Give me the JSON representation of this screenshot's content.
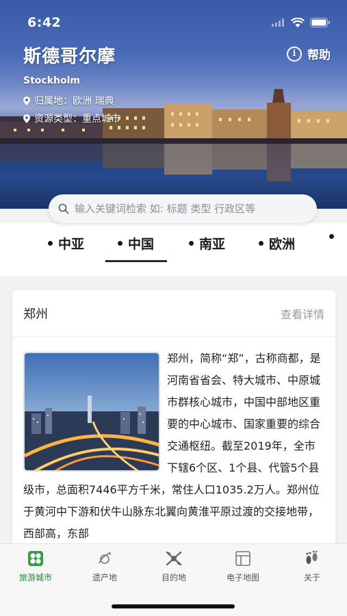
{
  "status": {
    "time": "6:42"
  },
  "hero": {
    "title": "斯德哥尔摩",
    "subtitle": "Stockholm",
    "region_label": "归属地：欧洲 瑞典",
    "resource_label": "资源类型：重点城市",
    "help_label": "帮助"
  },
  "search": {
    "placeholder": "输入关键词检索 如: 标题 类型 行政区等"
  },
  "tabs": [
    {
      "label": ""
    },
    {
      "label": "中亚"
    },
    {
      "label": "中国"
    },
    {
      "label": "南亚"
    },
    {
      "label": "欧洲"
    },
    {
      "label": ""
    }
  ],
  "active_tab": "中国",
  "card": {
    "title": "郑州",
    "link": "查看详情",
    "description": "郑州，简称“郑”，古称商都，是河南省省会、特大城市、中原城市群核心城市，中国中部地区重要的中心城市、国家重要的综合交通枢纽。截至2019年，全市下辖6个区、1个县、代管5个县级市，总面积7446平方千米，常住人口1035.2万人。郑州位于黄河中下游和伏牛山脉东北翼向黄淮平原过渡的交接地带，西部高，东部"
  },
  "bottom_nav": [
    {
      "label": "旅游城市",
      "icon": "city-grid-icon",
      "active": true
    },
    {
      "label": "遗产地",
      "icon": "heritage-icon",
      "active": false
    },
    {
      "label": "目的地",
      "icon": "destination-icon",
      "active": false
    },
    {
      "label": "电子地图",
      "icon": "map-icon",
      "active": false
    },
    {
      "label": "关于",
      "icon": "about-icon",
      "active": false
    }
  ],
  "colors": {
    "accent": "#2f7d3a",
    "tab_underline": "#1e2a3a"
  }
}
